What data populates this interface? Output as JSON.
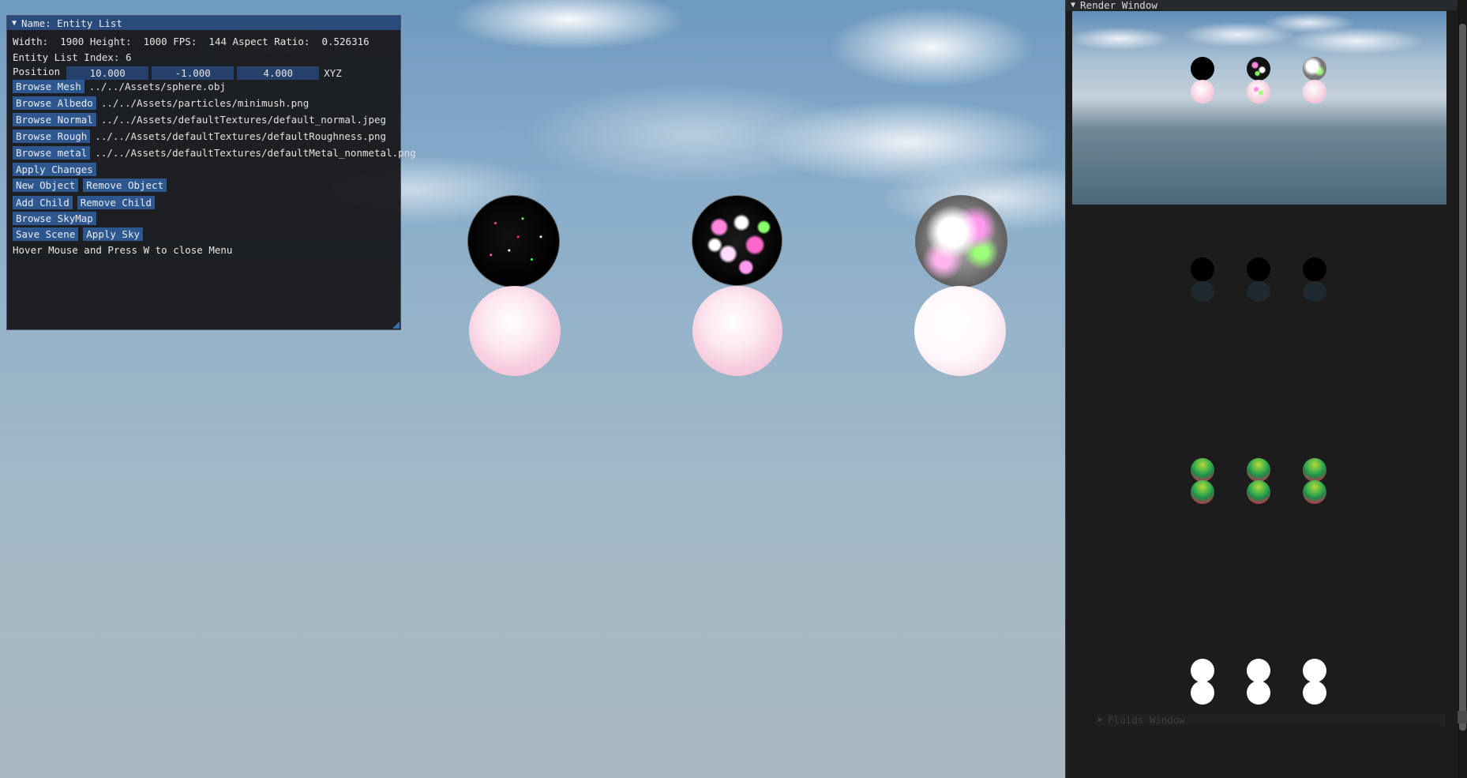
{
  "entity_panel": {
    "title": "Name: Entity List",
    "stats": {
      "width_label": "Width:",
      "width": "1900",
      "height_label": "Height:",
      "height": "1000",
      "fps_label": "FPS:",
      "fps": "144",
      "aspect_label": "Aspect Ratio:",
      "aspect": "0.526316"
    },
    "index_line": "Entity List Index: 6",
    "position_label": "Position",
    "position": [
      "10.000",
      "-1.000",
      "4.000"
    ],
    "position_suffix": "XYZ",
    "browse": [
      {
        "label": "Browse Mesh",
        "path": "../../Assets/sphere.obj"
      },
      {
        "label": "Browse Albedo",
        "path": "../../Assets/particles/minimush.png"
      },
      {
        "label": "Browse Normal",
        "path": "../../Assets/defaultTextures/default_normal.jpeg"
      },
      {
        "label": "Browse Rough",
        "path": "../../Assets/defaultTextures/defaultRoughness.png"
      },
      {
        "label": "Browse metal",
        "path": "../../Assets/defaultTextures/defaultMetal_nonmetal.png"
      }
    ],
    "apply_changes": "Apply Changes",
    "new_object": "New Object",
    "remove_object": "Remove Object",
    "add_child": "Add Child",
    "remove_child": "Remove Child",
    "browse_skymap": "Browse SkyMap",
    "save_scene": "Save Scene",
    "apply_sky": "Apply Sky",
    "hint": "Hover Mouse and Press W to close Menu"
  },
  "render_window": {
    "title": "Render Window",
    "collapsed_section": "Fluids Window"
  },
  "icons": {
    "collapse": "triangle-down-icon",
    "expand": "triangle-right-icon"
  },
  "colors": {
    "title_bar": "#294a7a",
    "button": "#2e5790",
    "input": "#24406b",
    "panel_bg": "#161618"
  }
}
